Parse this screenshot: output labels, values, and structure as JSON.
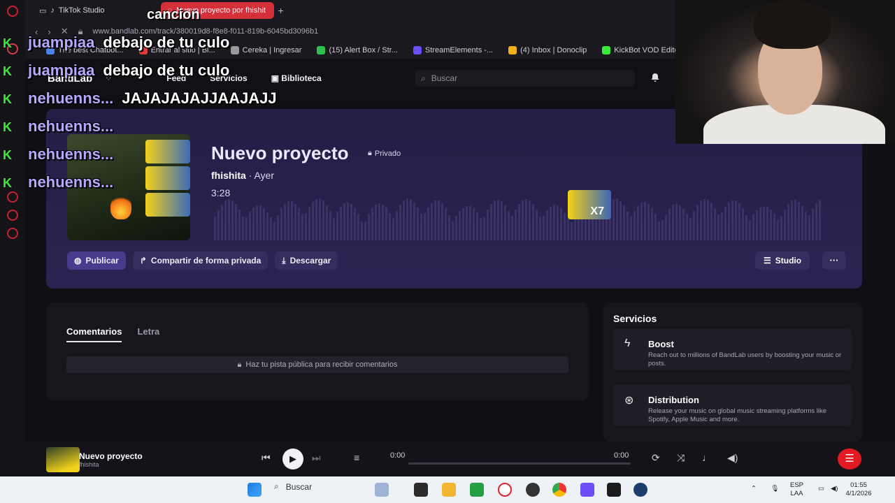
{
  "browser": {
    "tabs": [
      {
        "label": "TikTok Studio"
      },
      {
        "label": "Nuevo proyecto por fhishit"
      }
    ],
    "address": "www.bandlab.com/track/380019d8-f8e8-f011-819b-6045bd3096b1",
    "bookmarks": [
      {
        "label": "The best Chatbot...",
        "color": "#4a86e8"
      },
      {
        "label": "Entrar al sitio | Bl...",
        "color": "#e23a3a"
      },
      {
        "label": "Cereka | Ingresar",
        "color": "#9a9a9a"
      },
      {
        "label": "(15) Alert Box / Str...",
        "color": "#31c14a"
      },
      {
        "label": "StreamElements -...",
        "color": "#6b4cf5"
      },
      {
        "label": "(4) Inbox | Donoclip",
        "color": "#f2b11a"
      },
      {
        "label": "KickBot VOD Editor",
        "color": "#38e83a"
      }
    ]
  },
  "bandlab": {
    "logo": "BandLab",
    "nav": [
      "Feed",
      "Servicios",
      "Biblioteca"
    ],
    "search_placeholder": "Buscar"
  },
  "track": {
    "title": "Nuevo proyecto",
    "privacy": "Privado",
    "artist": "fhishita",
    "when": "· Ayer",
    "duration": "3:28",
    "sticker_label": "X7",
    "actions": {
      "publish": "Publicar",
      "share": "Compartir de forma privada",
      "download": "Descargar",
      "studio": "Studio",
      "more": "···"
    }
  },
  "comments": {
    "tabs": [
      "Comentarios",
      "Letra"
    ],
    "note": "Haz tu pista pública para recibir comentarios"
  },
  "services": {
    "title": "Servicios",
    "items": [
      {
        "title": "Boost",
        "desc": "Reach out to millions of BandLab users by boosting your music or posts."
      },
      {
        "title": "Distribution",
        "desc": "Release your music on global music streaming platforms like Spotify, Apple Music and more."
      }
    ]
  },
  "player": {
    "title": "Nuevo proyecto",
    "artist": "fhishita",
    "elapsed": "0:00",
    "total": "0:00"
  },
  "taskbar": {
    "search": "Buscar",
    "lang": "ESP",
    "layout": "LAA",
    "time": "01:55",
    "date": "4/1/2026"
  },
  "stream_chat": {
    "top": "cancion",
    "lines": [
      {
        "user": "juampiaa",
        "msg": "debajo de tu culo"
      },
      {
        "user": "juampiaa",
        "msg": "debajo de tu culo"
      },
      {
        "user": "nehuenns...",
        "msg": "JAJAJAJAJJAAJAJJ"
      },
      {
        "user": "nehuenns...",
        "msg": ""
      },
      {
        "user": "nehuenns...",
        "msg": ""
      },
      {
        "user": "nehuenns...",
        "msg": ""
      }
    ]
  },
  "colors": {
    "accent": "#4a3a8e",
    "brand_red": "#e21b23",
    "hero_bg": "#2c2352"
  }
}
